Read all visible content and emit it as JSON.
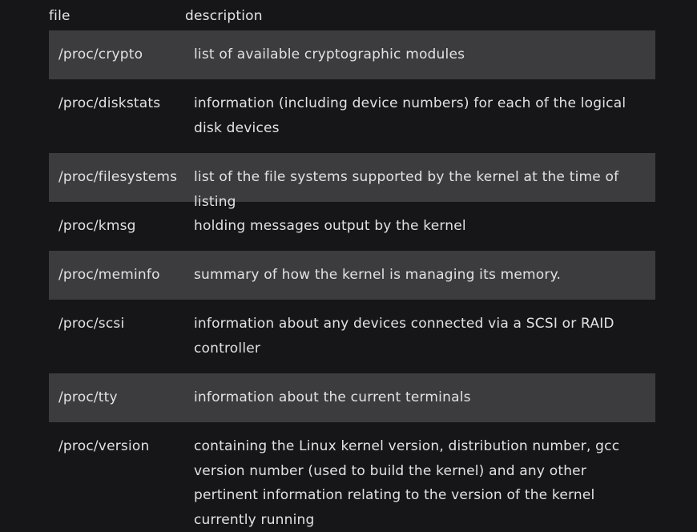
{
  "table": {
    "headers": {
      "file": "file",
      "description": "description"
    },
    "rows": [
      {
        "file": "/proc/crypto",
        "description": "list of available cryptographic modules"
      },
      {
        "file": "/proc/diskstats",
        "description": "information (including device numbers) for each of the logical disk devices"
      },
      {
        "file": "/proc/filesystems",
        "description": "list of the file systems supported by the kernel at the time of listing"
      },
      {
        "file": "/proc/kmsg",
        "description": "holding messages output by the kernel"
      },
      {
        "file": "/proc/meminfo",
        "description": "summary of how the kernel is managing its memory."
      },
      {
        "file": "/proc/scsi",
        "description": "information about any devices connected via a SCSI or RAID controller"
      },
      {
        "file": "/proc/tty",
        "description": "information about the current terminals"
      },
      {
        "file": "/proc/version",
        "description": "containing the Linux kernel version, distribution number, gcc version number (used to build the kernel) and any other pertinent information relating to the version of the kernel currently running"
      }
    ]
  },
  "colors": {
    "background": "#161618",
    "row_shade": "#3c3c3e",
    "text": "#e2e2e2"
  }
}
